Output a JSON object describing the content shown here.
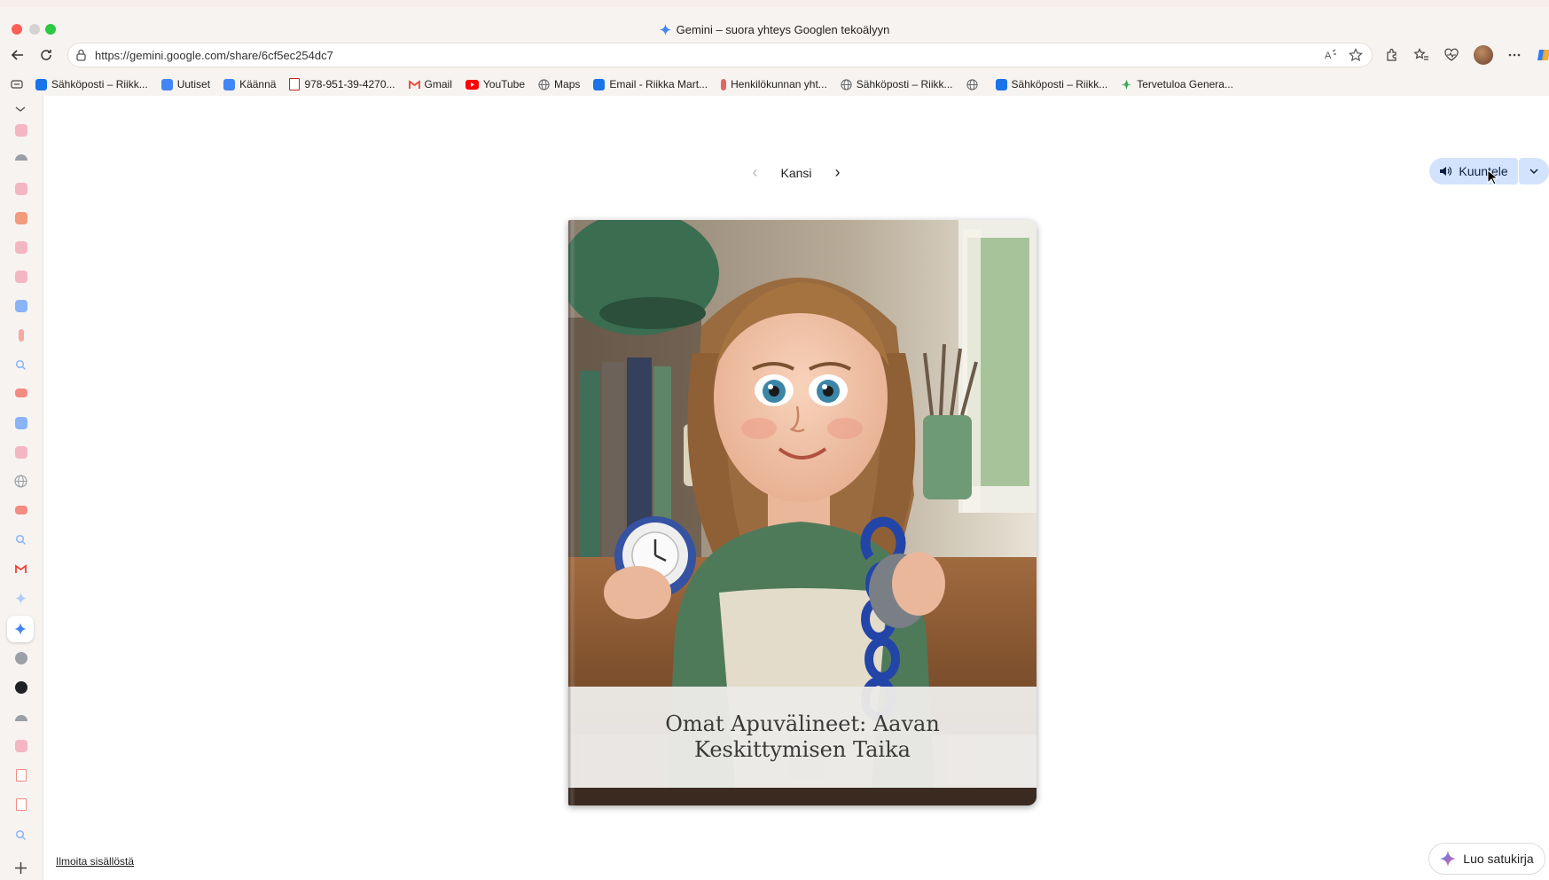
{
  "window": {
    "title": "Gemini – suora yhteys Googlen tekoälyyn"
  },
  "browser": {
    "url": "https://gemini.google.com/share/6cf5ec254dc7"
  },
  "bookmarks": [
    {
      "label": "Sähköposti – Riikk...",
      "icon": "outlook-icon",
      "color": "#1a73e8"
    },
    {
      "label": "Uutiset",
      "icon": "news-icon",
      "color": "#4285f4"
    },
    {
      "label": "Käännä",
      "icon": "translate-icon",
      "color": "#4285f4"
    },
    {
      "label": "978-951-39-4270...",
      "icon": "pdf-icon",
      "color": "#c5221f"
    },
    {
      "label": "Gmail",
      "icon": "gmail-icon",
      "color": "#ea4335"
    },
    {
      "label": "YouTube",
      "icon": "youtube-icon",
      "color": "#ff0000"
    },
    {
      "label": "Maps",
      "icon": "globe-icon",
      "color": "#5f6368"
    },
    {
      "label": "Email - Riikka Mart...",
      "icon": "outlook-icon",
      "color": "#1a73e8"
    },
    {
      "label": "Henkilökunnan yht...",
      "icon": "intranet-icon",
      "color": "#e06666"
    },
    {
      "label": "Sähköposti – Riikk...",
      "icon": "globe-icon",
      "color": "#5f6368"
    },
    {
      "label": "",
      "icon": "globe-icon",
      "color": "#5f6368"
    },
    {
      "label": "Sähköposti – Riikk...",
      "icon": "outlook-icon",
      "color": "#1a73e8"
    },
    {
      "label": "Tervetuloa Genera...",
      "icon": "generative-icon",
      "color": "#34a853"
    }
  ],
  "storybook": {
    "page_label": "Kansi",
    "listen_label": "Kuuntele",
    "cover_title": "Omat Apuvälineet: Aavan Keskittymisen Taika"
  },
  "footer": {
    "report_label": "Ilmoita sisällöstä",
    "create_label": "Luo satukirja"
  },
  "colors": {
    "accent": "#d3e3fd",
    "cover_green": "#4f7a5a"
  }
}
